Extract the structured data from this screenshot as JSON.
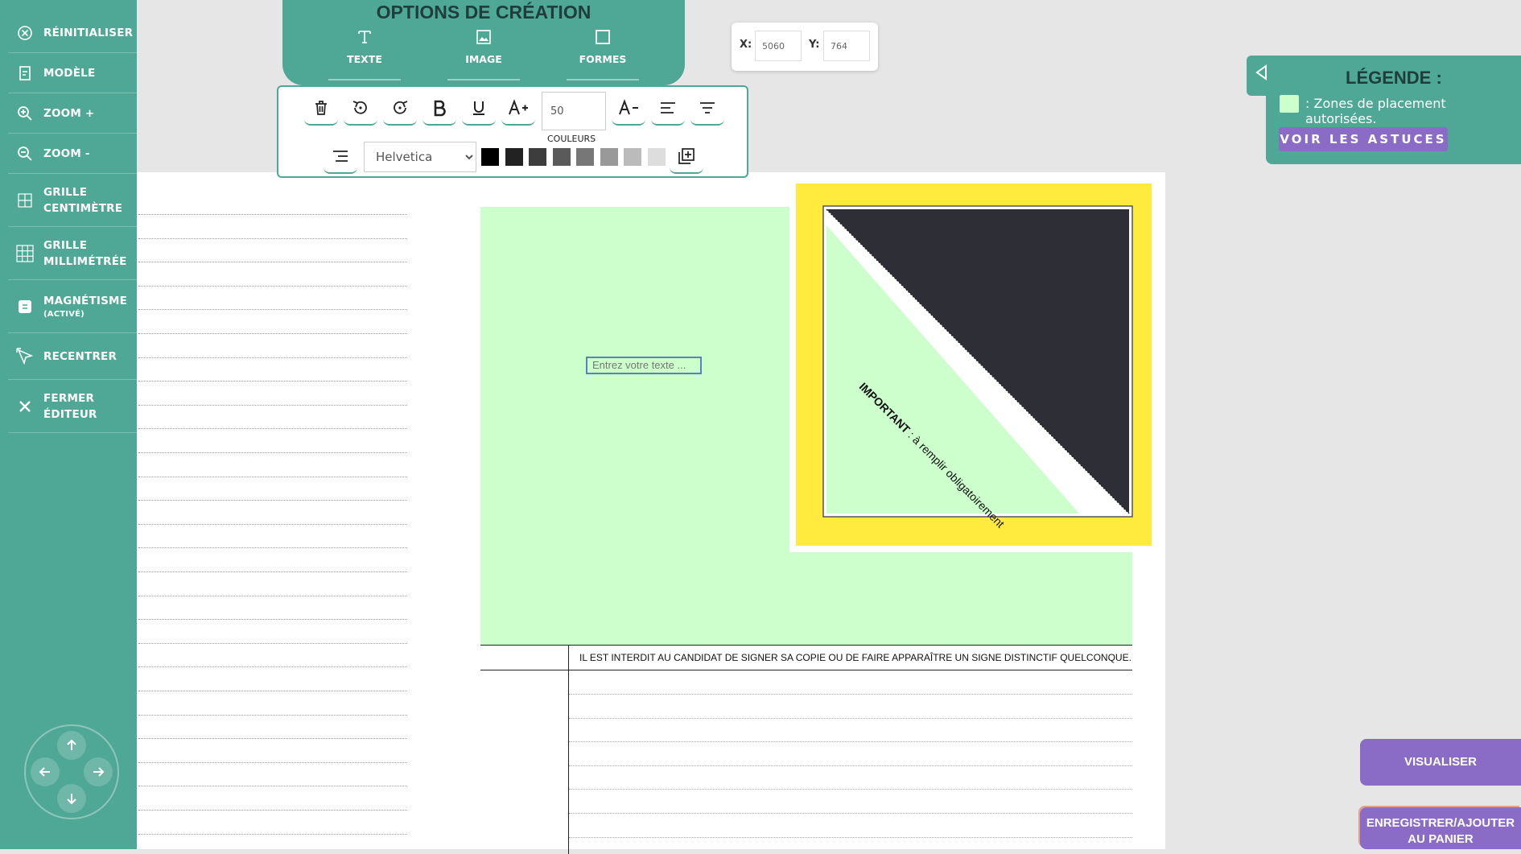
{
  "sidebar": {
    "items": [
      {
        "label": "RÉINITIALISER",
        "icon": "reset-icon"
      },
      {
        "label": "MODÈLE",
        "icon": "template-icon"
      },
      {
        "label": "ZOOM +",
        "icon": "zoom-in-icon"
      },
      {
        "label": "ZOOM -",
        "icon": "zoom-out-icon"
      },
      {
        "label": "GRILLE CENTIMÈTRE",
        "icon": "grid-cm-icon"
      },
      {
        "label": "GRILLE MILLIMÉTRÉE",
        "icon": "grid-mm-icon"
      },
      {
        "label": "MAGNÉTISME",
        "sublabel": "(ACTIVÉ)",
        "icon": "magnet-icon"
      },
      {
        "label": "RECENTRER",
        "icon": "recenter-icon"
      },
      {
        "label": "FERMER ÉDITEUR",
        "icon": "close-icon"
      }
    ]
  },
  "creation": {
    "title": "OPTIONS DE CRÉATION",
    "tools": [
      {
        "label": "TEXTE",
        "icon": "text-icon"
      },
      {
        "label": "IMAGE",
        "icon": "image-icon"
      },
      {
        "label": "FORMES",
        "icon": "shape-square-icon"
      }
    ]
  },
  "toolbar": {
    "font_size": "50",
    "colors_label": "COULEURS",
    "font_family": "Helvetica",
    "font_options": [
      "Helvetica"
    ],
    "swatches": [
      "#000000",
      "#222222",
      "#3d3d3d",
      "#5a5a5a",
      "#777777",
      "#999999",
      "#bbbbbb",
      "#dddddd"
    ]
  },
  "coords": {
    "x_label": "X:",
    "x_value": "5060",
    "y_label": "Y:",
    "y_value": "764"
  },
  "legend": {
    "title": "LÉGENDE :",
    "item_text": ": Zones de placement autorisées.",
    "tips_button": "VOIR LES ASTUCES"
  },
  "canvas": {
    "text_placeholder": "Entrez votre texte ...",
    "important_label": "IMPORTANT",
    "important_rest": " : à remplir obligatoirement",
    "warning": "IL EST INTERDIT AU CANDIDAT DE SIGNER SA COPIE OU DE FAIRE APPARAÎTRE UN SIGNE DISTINCTIF QUELCONQUE."
  },
  "actions": {
    "preview": "VISUALISER",
    "save": "ENREGISTRER/AJOUTER AU PANIER"
  },
  "colors": {
    "teal": "#4fa896",
    "purple": "#8a6cc6",
    "allowed_zone": "#ccffcc",
    "yellow": "#ffea3d",
    "dark": "#2e2e36"
  }
}
